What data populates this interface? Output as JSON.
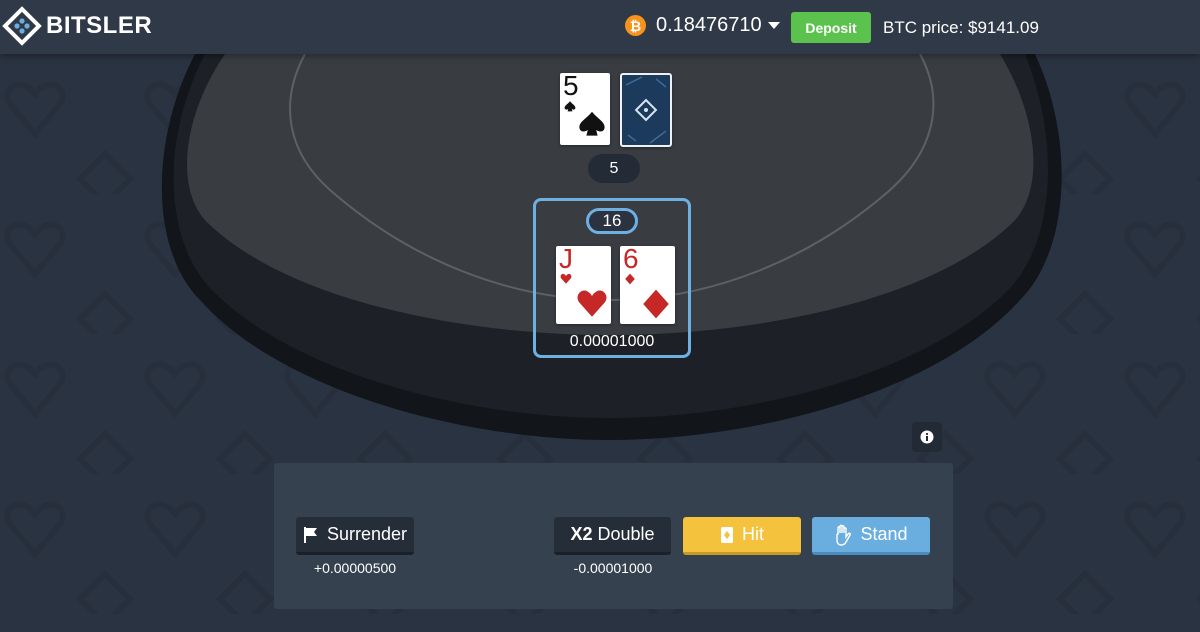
{
  "header": {
    "logo_text": "BITSLER",
    "currency_symbol": "₿",
    "balance": "0.18476710",
    "deposit_label": "Deposit",
    "btc_price": "BTC price: $9141.09"
  },
  "dealer": {
    "cards": [
      {
        "rank": "5",
        "suit": "spades",
        "color": "#111111"
      }
    ],
    "hidden_card": "card-back",
    "hand_value": "5"
  },
  "player": {
    "hand_value": "16",
    "cards": [
      {
        "rank": "J",
        "suit": "hearts",
        "color": "#c62828"
      },
      {
        "rank": "6",
        "suit": "diamonds",
        "color": "#c62828"
      }
    ],
    "bet": "0.00001000"
  },
  "actions": {
    "surrender": {
      "label": "Surrender",
      "icon": "flag-icon",
      "note": "+0.00000500"
    },
    "double": {
      "prefix": "X2",
      "label": "Double",
      "note": "-0.00001000"
    },
    "hit": {
      "label": "Hit",
      "icon": "card-icon"
    },
    "stand": {
      "label": "Stand",
      "icon": "hand-icon"
    }
  },
  "colors": {
    "accent_blue": "#6aaee0",
    "hit_yellow": "#f4c23d",
    "deposit_green": "#5cc24e",
    "btc_orange": "#f7931a"
  }
}
